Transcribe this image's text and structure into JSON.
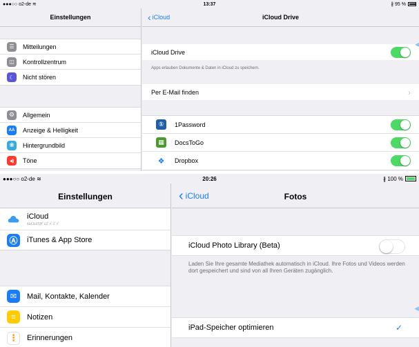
{
  "shot1": {
    "status": {
      "carrier": "●●●○○ o2-de ≋",
      "time": "13:37",
      "battery": "∦ 95 %"
    },
    "sidebar": {
      "title": "Einstellungen",
      "group1": [
        {
          "label": "Mitteilungen",
          "color": "#8e8e93",
          "icon_glyph": "☰"
        },
        {
          "label": "Kontrollzentrum",
          "color": "#8e8e93",
          "icon_glyph": "◫"
        },
        {
          "label": "Nicht stören",
          "color": "#5856d6",
          "icon_glyph": "☾"
        }
      ],
      "group2": [
        {
          "label": "Allgemein",
          "color": "#8e8e93",
          "icon_glyph": "⚙"
        },
        {
          "label": "Anzeige & Helligkeit",
          "color": "#1a7cf6",
          "icon_glyph": "AA"
        },
        {
          "label": "Hintergrundbild",
          "color": "#35aadc",
          "icon_glyph": "❀"
        },
        {
          "label": "Töne",
          "color": "#ff3b30",
          "icon_glyph": "◀)"
        }
      ]
    },
    "detail": {
      "back": "iCloud",
      "title": "iCloud Drive",
      "drive_label": "iCloud Drive",
      "drive_note": "Apps erlauben Dokumente & Daten in iCloud zu speichern.",
      "find_label": "Per E-Mail finden",
      "apps": [
        {
          "label": "1Password",
          "color": "#1f5fa8",
          "icon_glyph": "①"
        },
        {
          "label": "DocsToGo",
          "color": "#4a9a2e",
          "icon_glyph": "▦"
        },
        {
          "label": "Dropbox",
          "color": "#ffffff",
          "icon_glyph": "❖",
          "glyph_color": "#1f7fe0"
        }
      ]
    }
  },
  "shot2": {
    "status": {
      "carrier": "●●●○○ o2-de ≋",
      "time": "20:26",
      "battery": "∦ 100 %"
    },
    "sidebar": {
      "title": "Einstellungen",
      "icloud": {
        "label": "iCloud",
        "sub": "ﾎﾑﾎｺﾑﾓｸﾛﾔﾞﾑｽﾞﾊﾞｽﾞﾊﾞ"
      },
      "itunes": "iTunes & App Store",
      "group3": [
        {
          "label": "Mail, Kontakte, Kalender",
          "color": "#1a7cf6",
          "icon_glyph": "✉"
        },
        {
          "label": "Notizen",
          "color": "#ffcc00",
          "icon_glyph": "≡"
        },
        {
          "label": "Erinnerungen",
          "color": "#ffffff",
          "icon_glyph": "⋮",
          "glyph_color": "#ff9500"
        }
      ]
    },
    "detail": {
      "back": "iCloud",
      "title": "Fotos",
      "library_label": "iCloud Photo Library (Beta)",
      "library_note": "Laden Sie Ihre gesamte Mediathek automatisch in iCloud. Ihre Fotos und Videos werden dort gespeichert und sind von all Ihren Geräten zugänglich.",
      "optimize_label": "iPad-Speicher optimieren"
    }
  },
  "colors": {
    "accent": "#1a7cf6",
    "toggle_on": "#4cd964",
    "background": "#efeff4",
    "battery_green": "#4cd964"
  }
}
